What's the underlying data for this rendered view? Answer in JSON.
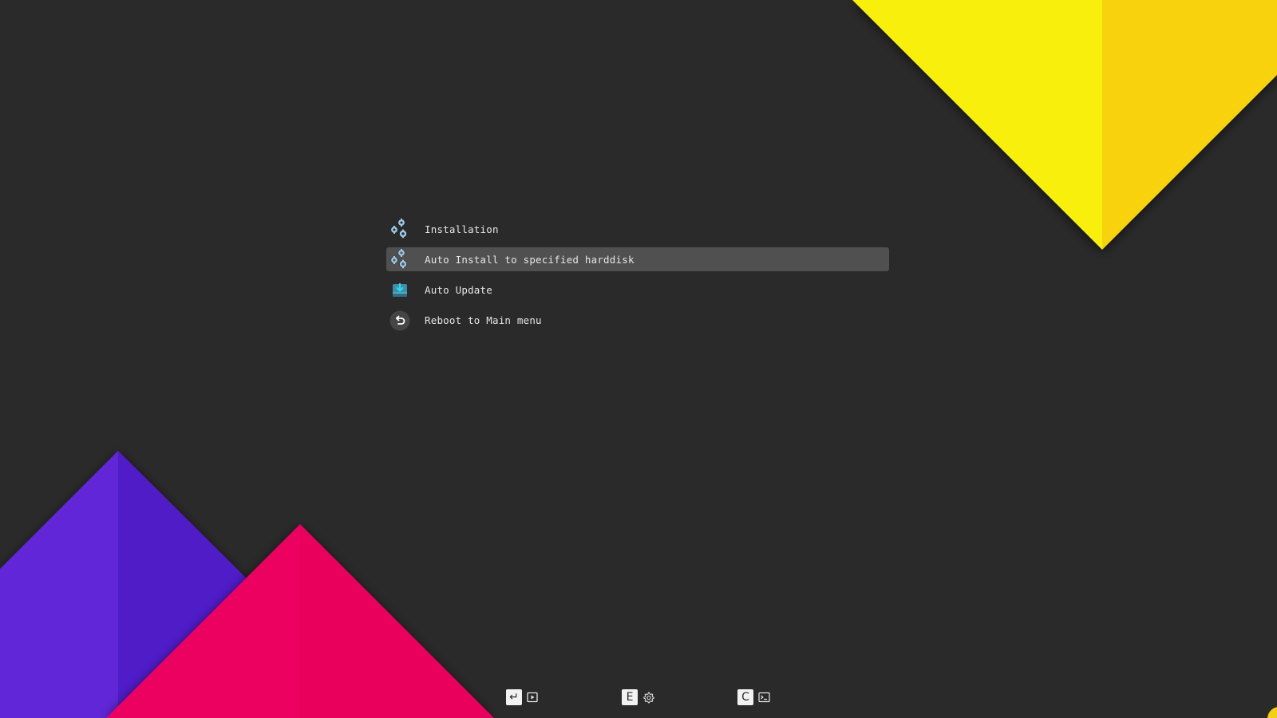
{
  "menu": {
    "items": [
      {
        "label": "Installation",
        "icon": "gears-icon",
        "selected": false
      },
      {
        "label": "Auto Install to specified harddisk",
        "icon": "gears-icon",
        "selected": true
      },
      {
        "label": "Auto Update",
        "icon": "download-drive-icon",
        "selected": false
      },
      {
        "label": "Reboot to Main menu",
        "icon": "return-icon",
        "selected": false
      }
    ]
  },
  "footer": {
    "hints": [
      {
        "key": "↵",
        "icon": "boot-icon"
      },
      {
        "key": "E",
        "icon": "gear-icon"
      },
      {
        "key": "C",
        "icon": "terminal-icon"
      }
    ]
  },
  "colors": {
    "background": "#2a2a2a",
    "selection": "#505050",
    "yellow": "#f9ef0a",
    "yellow_dark": "#f7d208",
    "purple": "#6028d8",
    "purple_dark": "#4f1dc8",
    "pink": "#ec0660",
    "menu_text": "#e6e6e6"
  }
}
